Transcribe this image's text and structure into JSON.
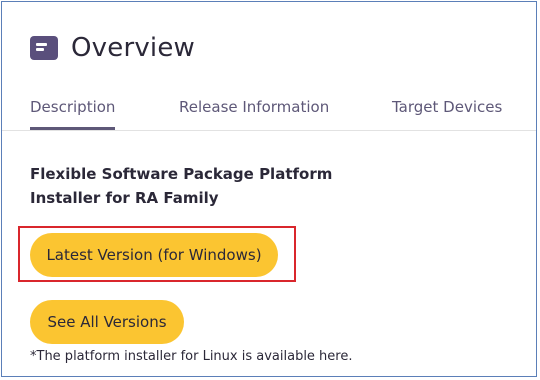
{
  "header": {
    "icon": "document-card-icon",
    "title": "Overview"
  },
  "tabs": [
    {
      "label": "Description",
      "active": true
    },
    {
      "label": "Release Information",
      "active": false
    },
    {
      "label": "Target Devices",
      "active": false
    }
  ],
  "content": {
    "product_name": "Flexible Software Package Platform Installer for RA Family",
    "latest_button": "Latest Version (for Windows)",
    "all_versions_button": "See All Versions",
    "footnote": "*The platform installer for Linux is available here."
  },
  "colors": {
    "accent": "#5e5878",
    "button": "#fbc531",
    "highlight": "#d9262c",
    "frame": "#5b7fb8"
  }
}
